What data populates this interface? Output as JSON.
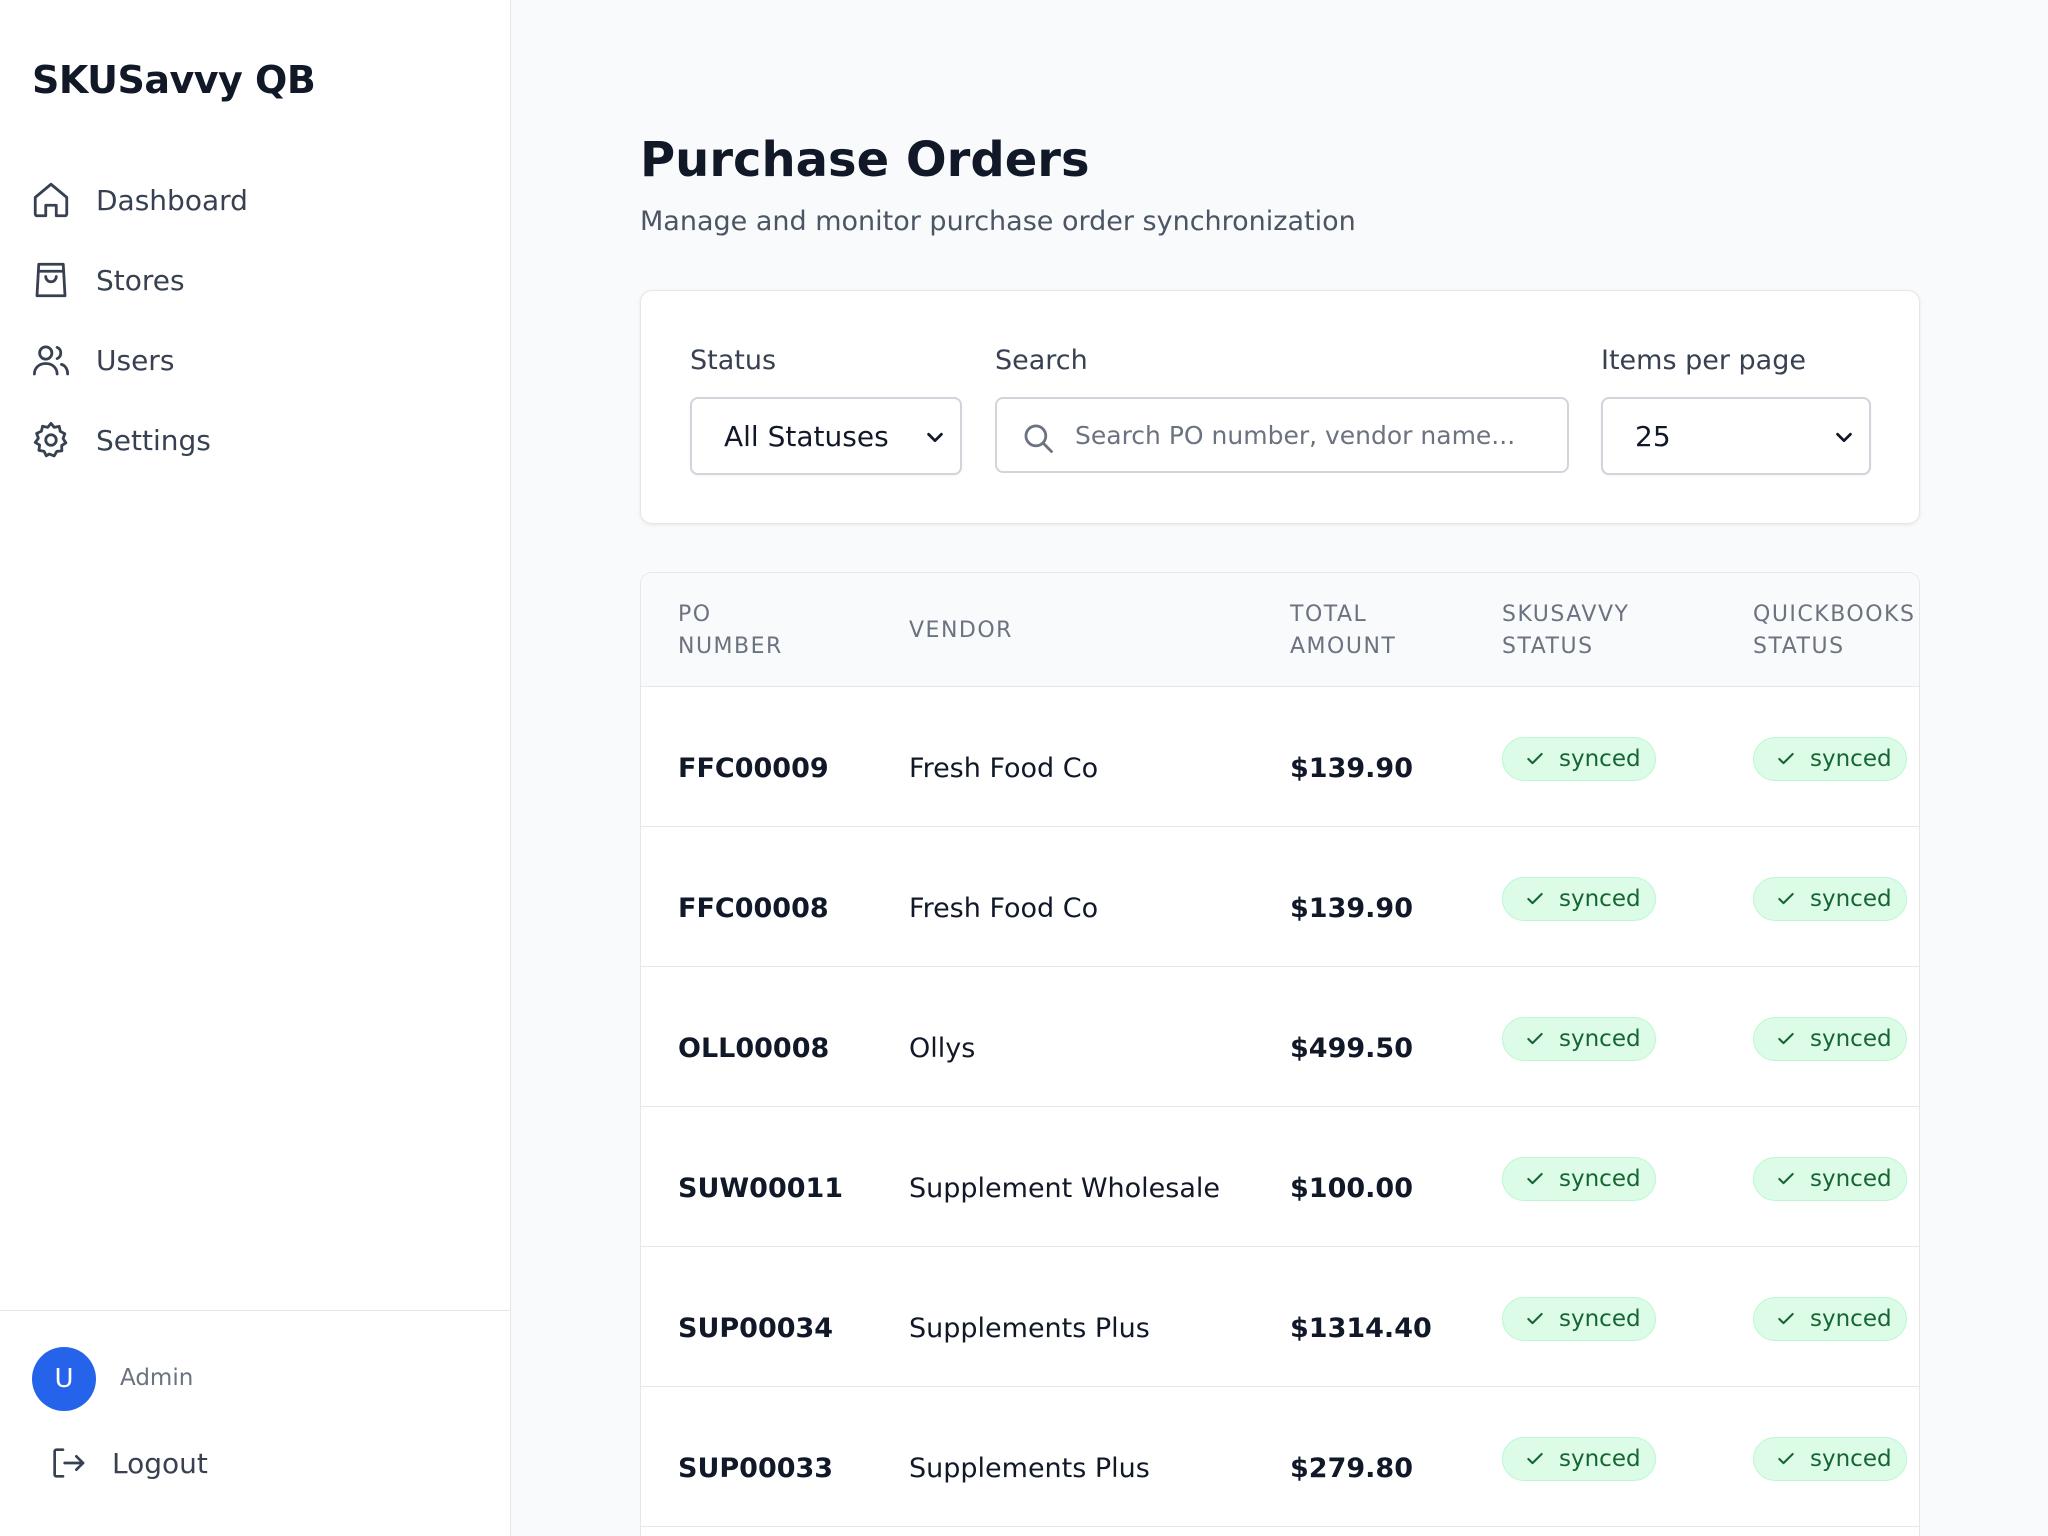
{
  "app": {
    "brand": "SKUSavvy QB"
  },
  "sidebar": {
    "items": [
      {
        "label": "Dashboard",
        "icon": "home-icon"
      },
      {
        "label": "Stores",
        "icon": "shopping-bag-icon"
      },
      {
        "label": "Users",
        "icon": "users-icon"
      },
      {
        "label": "Settings",
        "icon": "gear-icon"
      }
    ],
    "user": {
      "avatar_initial": "U",
      "role": "Admin"
    },
    "logout_label": "Logout"
  },
  "page": {
    "title": "Purchase Orders",
    "subtitle": "Manage and monitor purchase order synchronization"
  },
  "filters": {
    "status_label": "Status",
    "status_value": "All Statuses",
    "search_label": "Search",
    "search_placeholder": "Search PO number, vendor name...",
    "per_page_label": "Items per page",
    "per_page_value": "25"
  },
  "table": {
    "headers": {
      "po_number": "PO\nNUMBER",
      "vendor": "VENDOR",
      "total_amount": "TOTAL\nAMOUNT",
      "skusavvy_status": "SKUSAVVY\nSTATUS",
      "quickbooks_status": "QUICKBOOKS\nSTATUS"
    },
    "rows": [
      {
        "po": "FFC00009",
        "vendor": "Fresh Food Co",
        "amount": "$139.90",
        "skusavvy": "synced",
        "quickbooks": "synced"
      },
      {
        "po": "FFC00008",
        "vendor": "Fresh Food Co",
        "amount": "$139.90",
        "skusavvy": "synced",
        "quickbooks": "synced"
      },
      {
        "po": "OLL00008",
        "vendor": "Ollys",
        "amount": "$499.50",
        "skusavvy": "synced",
        "quickbooks": "synced"
      },
      {
        "po": "SUW00011",
        "vendor": "Supplement Wholesale",
        "amount": "$100.00",
        "skusavvy": "synced",
        "quickbooks": "synced"
      },
      {
        "po": "SUP00034",
        "vendor": "Supplements Plus",
        "amount": "$1314.40",
        "skusavvy": "synced",
        "quickbooks": "synced"
      },
      {
        "po": "SUP00033",
        "vendor": "Supplements Plus",
        "amount": "$279.80",
        "skusavvy": "synced",
        "quickbooks": "synced"
      }
    ]
  },
  "colors": {
    "accent": "#2563eb",
    "badge_bg": "#dcfce7",
    "badge_text": "#166534"
  }
}
